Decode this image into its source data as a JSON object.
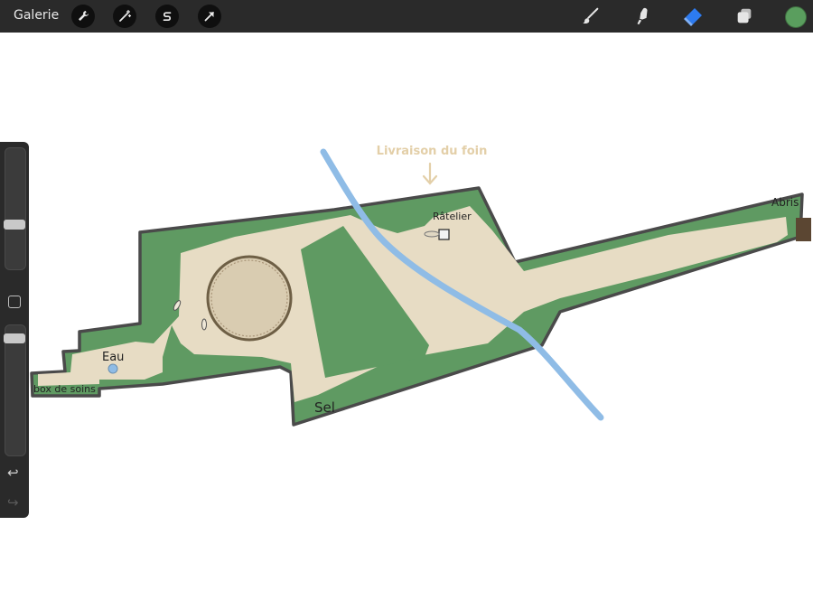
{
  "toolbar": {
    "gallery_label": "Galerie",
    "left_tools": [
      {
        "name": "wrench-icon"
      },
      {
        "name": "magic-wand-icon"
      },
      {
        "name": "selection-s-icon"
      },
      {
        "name": "arrow-cursor-icon"
      }
    ],
    "right_tools": [
      {
        "name": "brush-icon"
      },
      {
        "name": "smudge-icon"
      },
      {
        "name": "eraser-icon",
        "active": true
      },
      {
        "name": "layers-icon"
      }
    ],
    "current_color": "#5a9e5e",
    "accent_color": "#2d7bf0"
  },
  "sidebar": {
    "undo_icon": "undo-icon",
    "redo_icon": "redo-icon"
  },
  "map": {
    "labels": {
      "hay_delivery": "Livraison du foin",
      "rack": "Râtelier",
      "shelter": "Abris",
      "water": "Eau",
      "care_box": "box de soins",
      "salt": "Sel"
    },
    "colors": {
      "grass": "#5f9a62",
      "path": "#e7dcc4",
      "stream": "#8fbce6",
      "outline": "#4a4a4a",
      "arena": "#d9ccb1",
      "annotation": "#e3cfa8"
    }
  }
}
